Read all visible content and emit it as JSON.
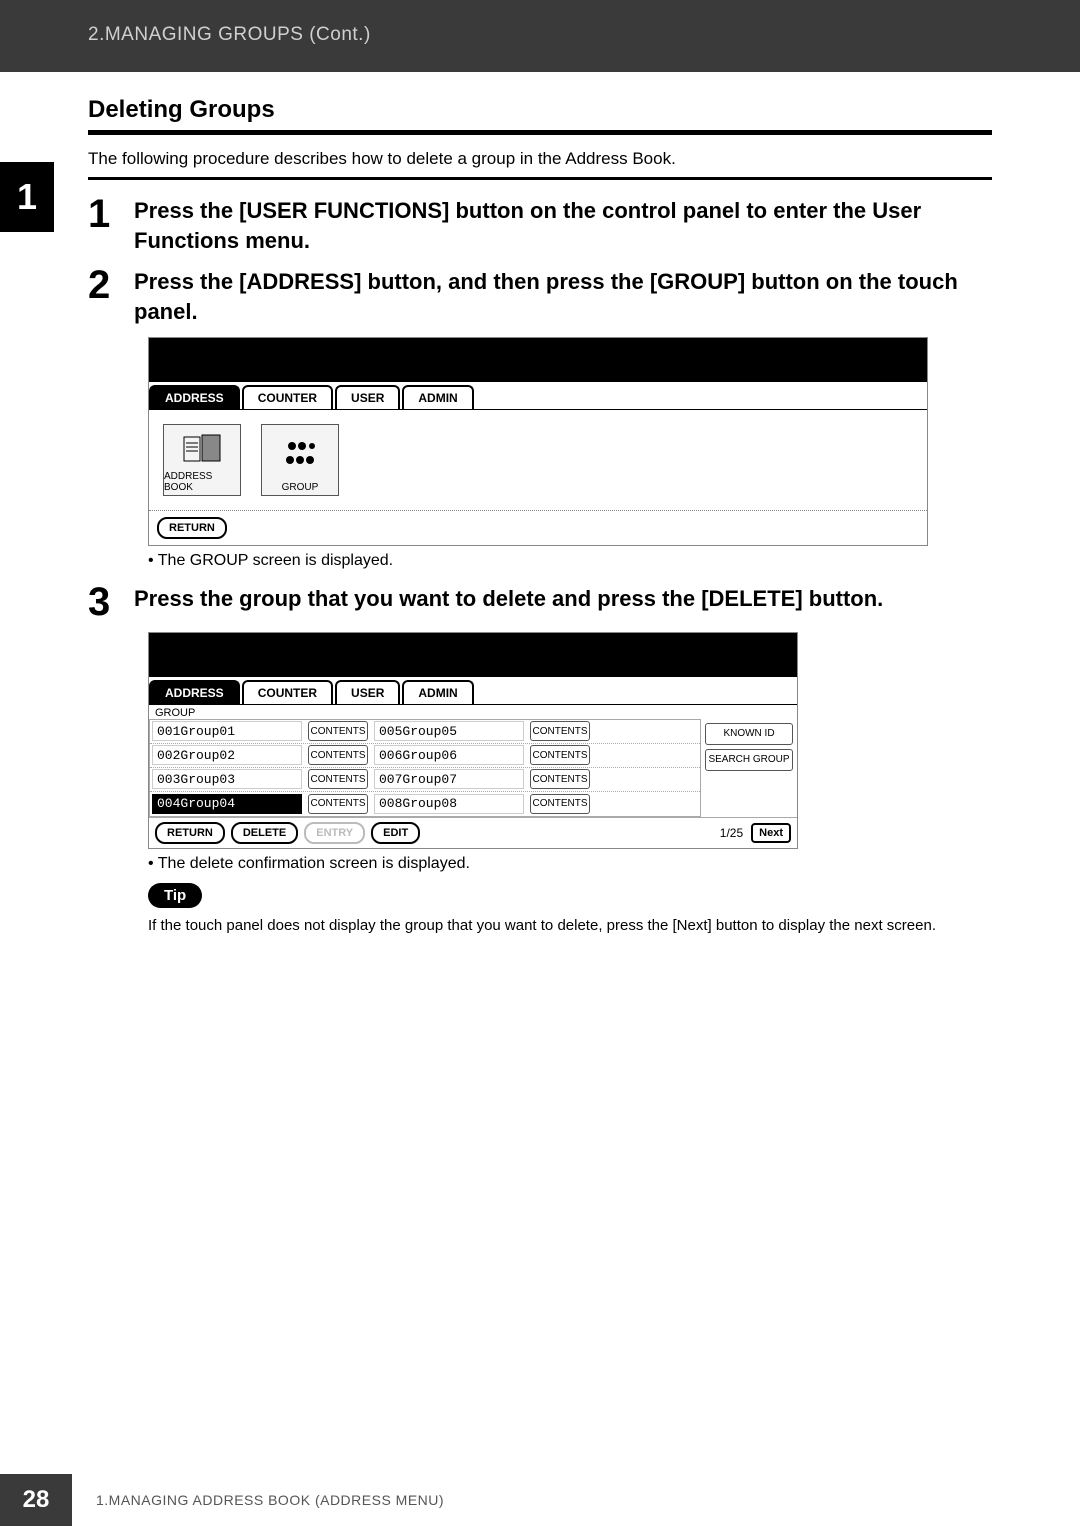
{
  "header": {
    "breadcrumb": "2.MANAGING GROUPS (Cont.)"
  },
  "sideTab": "1",
  "section": {
    "title": "Deleting Groups",
    "intro": "The following procedure describes how to delete a group in the Address Book."
  },
  "steps": [
    {
      "num": "1",
      "text": "Press the [USER FUNCTIONS] button on the control panel to enter the User Functions menu."
    },
    {
      "num": "2",
      "text": "Press the [ADDRESS] button, and then press the [GROUP] button on the touch panel."
    },
    {
      "num": "3",
      "text": "Press the group that you want to delete and press the [DELETE] button."
    }
  ],
  "shot1": {
    "tabs": [
      "ADDRESS",
      "COUNTER",
      "USER",
      "ADMIN"
    ],
    "icons": {
      "addressBook": "ADDRESS BOOK",
      "group": "GROUP"
    },
    "return": "RETURN",
    "note": "The GROUP screen is displayed."
  },
  "shot2": {
    "tabs": [
      "ADDRESS",
      "COUNTER",
      "USER",
      "ADMIN"
    ],
    "groupLabel": "GROUP",
    "rowsLeft": [
      {
        "id": "001",
        "name": "Group01"
      },
      {
        "id": "002",
        "name": "Group02"
      },
      {
        "id": "003",
        "name": "Group03"
      },
      {
        "id": "004",
        "name": "Group04"
      }
    ],
    "rowsRight": [
      {
        "id": "005",
        "name": "Group05"
      },
      {
        "id": "006",
        "name": "Group06"
      },
      {
        "id": "007",
        "name": "Group07"
      },
      {
        "id": "008",
        "name": "Group08"
      }
    ],
    "contentsLabel": "CONTENTS",
    "sideButtons": {
      "knownId": "KNOWN ID",
      "searchGroup": "SEARCH GROUP"
    },
    "bottom": {
      "return": "RETURN",
      "delete": "DELETE",
      "entry": "ENTRY",
      "edit": "EDIT",
      "page": "1/25",
      "next": "Next"
    },
    "note": "The delete confirmation screen is displayed."
  },
  "tip": {
    "label": "Tip",
    "text": "If the touch panel does not display the group that you want to delete, press the [Next] button to display the next screen."
  },
  "footer": {
    "page": "28",
    "text": "1.MANAGING ADDRESS BOOK (ADDRESS MENU)"
  }
}
